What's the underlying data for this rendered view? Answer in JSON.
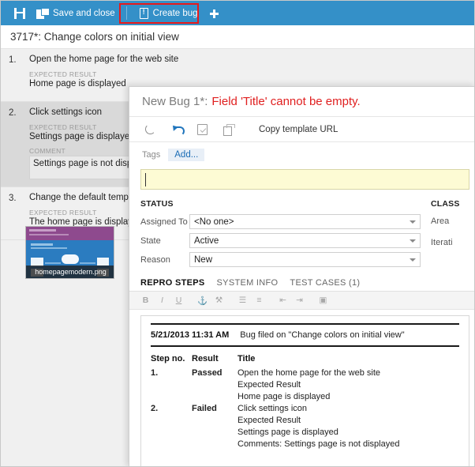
{
  "toolbar": {
    "save_label": "",
    "save_icon": "floppy-disk-icon",
    "save_and_close_label": "Save and close",
    "save_and_close_icon": "save-and-close-icon",
    "create_bug_label": "Create bug",
    "create_bug_icon": "bug-document-icon",
    "add_icon": "plus-icon",
    "accent_color": "#3490c8",
    "highlight_color": "#e8191b"
  },
  "workitem": {
    "title": "3717*: Change colors on initial view"
  },
  "steps": [
    {
      "number": "1.",
      "title": "Open the home page for the web site",
      "expected_label": "EXPECTED RESULT",
      "expected_value": "Home page is displayed",
      "selected": false
    },
    {
      "number": "2.",
      "title": "Click settings icon",
      "expected_label": "EXPECTED RESULT",
      "expected_value": "Settings page is displayed",
      "comment_label": "COMMENT",
      "comment_value": "Settings page is not displ",
      "selected": true
    },
    {
      "number": "3.",
      "title": "Change the default templ",
      "expected_label": "EXPECTED RESULT",
      "expected_value": "The home page is display",
      "selected": false
    }
  ],
  "attachment": {
    "filename": "homepagemodern.png"
  },
  "dialog": {
    "title": "New Bug 1*:",
    "error": "Field 'Title' cannot be empty.",
    "toolbar": {
      "refresh_icon": "refresh-icon",
      "undo_icon": "undo-icon",
      "apply_template_icon": "apply-template-icon",
      "copy_icon": "copy-icon",
      "copy_template_url_label": "Copy template URL"
    },
    "tags": {
      "label": "Tags",
      "add_label": "Add..."
    },
    "title_field": {
      "value": "",
      "placeholder": ""
    },
    "status": {
      "heading": "STATUS",
      "fields": [
        {
          "label": "Assigned To",
          "value": "<No one>"
        },
        {
          "label": "State",
          "value": "Active"
        },
        {
          "label": "Reason",
          "value": "New"
        }
      ]
    },
    "classification": {
      "heading": "CLASS",
      "fields": [
        {
          "label": "Area"
        },
        {
          "label": "Iterati"
        }
      ]
    },
    "tabs": [
      {
        "label": "REPRO STEPS",
        "active": true
      },
      {
        "label": "SYSTEM INFO",
        "active": false
      },
      {
        "label": "TEST CASES (1)",
        "active": false
      }
    ],
    "format_toolbar": [
      {
        "name": "bold-icon",
        "glyph": "B",
        "style": "b"
      },
      {
        "name": "italic-icon",
        "glyph": "I",
        "style": "i"
      },
      {
        "name": "underline-icon",
        "glyph": "U",
        "style": "u"
      },
      {
        "name": "insert-link-icon",
        "glyph": "⚓",
        "style": ""
      },
      {
        "name": "remove-link-icon",
        "glyph": "⚒",
        "style": ""
      },
      {
        "name": "bullet-list-icon",
        "glyph": "☰",
        "style": ""
      },
      {
        "name": "numbered-list-icon",
        "glyph": "≡",
        "style": ""
      },
      {
        "name": "outdent-icon",
        "glyph": "⇤",
        "style": ""
      },
      {
        "name": "indent-icon",
        "glyph": "⇥",
        "style": ""
      },
      {
        "name": "insert-image-icon",
        "glyph": "▣",
        "style": ""
      }
    ],
    "repro": {
      "filed_date": "5/21/2013 11:31 AM",
      "filed_text": "Bug filed on \"Change colors on initial view\"",
      "columns": [
        "Step no.",
        "Result",
        "Title"
      ],
      "rows": [
        {
          "step": "1.",
          "result": "Passed",
          "result_state": "pass",
          "title": "Open the home page for the web site",
          "expected_label": "Expected Result",
          "expected_value": "Home page is displayed",
          "comment": ""
        },
        {
          "step": "2.",
          "result": "Failed",
          "result_state": "fail",
          "title": "Click settings icon",
          "expected_label": "Expected Result",
          "expected_value": "Settings page is displayed",
          "comment": "Comments: Settings page is not displayed"
        }
      ]
    }
  }
}
